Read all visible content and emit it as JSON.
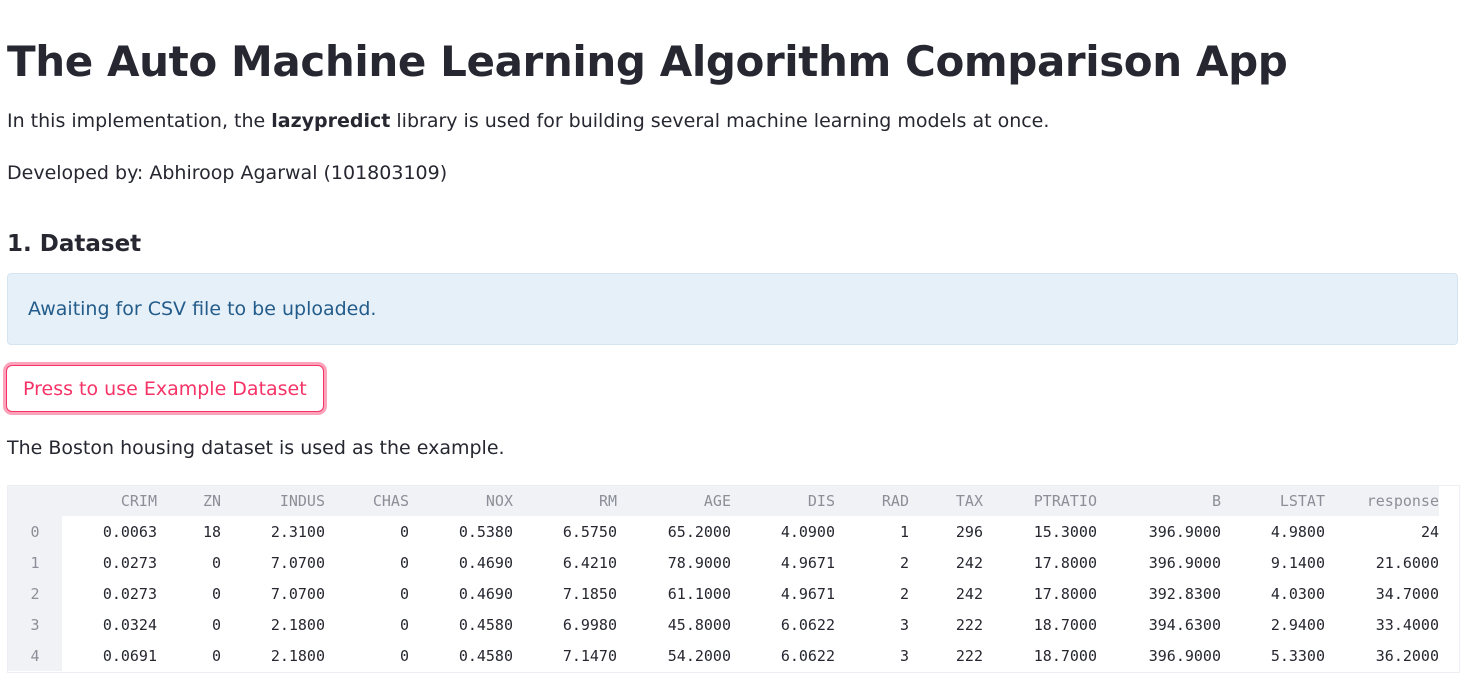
{
  "header": {
    "title": "The Auto Machine Learning Algorithm Comparison App"
  },
  "intro": {
    "prefix": "In this implementation, the ",
    "library": "lazypredict",
    "suffix": " library is used for building several machine learning models at once."
  },
  "developer": "Developed by: Abhiroop Agarwal (101803109)",
  "dataset_section": {
    "heading": "1. Dataset",
    "info_message": "Awaiting for CSV file to be uploaded.",
    "example_button_label": "Press to use Example Dataset",
    "example_note": "The Boston housing dataset is used as the example."
  },
  "colors": {
    "text": "#262730",
    "accent": "#f63366",
    "info_bg": "#e6f0f9",
    "info_text": "#235c8a",
    "table_header_bg": "#f0f2f6",
    "table_header_text": "#8c8f98"
  },
  "table": {
    "columns": [
      "CRIM",
      "ZN",
      "INDUS",
      "CHAS",
      "NOX",
      "RM",
      "AGE",
      "DIS",
      "RAD",
      "TAX",
      "PTRATIO",
      "B",
      "LSTAT",
      "response"
    ],
    "index": [
      "0",
      "1",
      "2",
      "3",
      "4"
    ],
    "rows": [
      [
        "0.0063",
        "18",
        "2.3100",
        "0",
        "0.5380",
        "6.5750",
        "65.2000",
        "4.0900",
        "1",
        "296",
        "15.3000",
        "396.9000",
        "4.9800",
        "24"
      ],
      [
        "0.0273",
        "0",
        "7.0700",
        "0",
        "0.4690",
        "6.4210",
        "78.9000",
        "4.9671",
        "2",
        "242",
        "17.8000",
        "396.9000",
        "9.1400",
        "21.6000"
      ],
      [
        "0.0273",
        "0",
        "7.0700",
        "0",
        "0.4690",
        "7.1850",
        "61.1000",
        "4.9671",
        "2",
        "242",
        "17.8000",
        "392.8300",
        "4.0300",
        "34.7000"
      ],
      [
        "0.0324",
        "0",
        "2.1800",
        "0",
        "0.4580",
        "6.9980",
        "45.8000",
        "6.0622",
        "3",
        "222",
        "18.7000",
        "394.6300",
        "2.9400",
        "33.4000"
      ],
      [
        "0.0691",
        "0",
        "2.1800",
        "0",
        "0.4580",
        "7.1470",
        "54.2000",
        "6.0622",
        "3",
        "222",
        "18.7000",
        "396.9000",
        "5.3300",
        "36.2000"
      ]
    ]
  }
}
